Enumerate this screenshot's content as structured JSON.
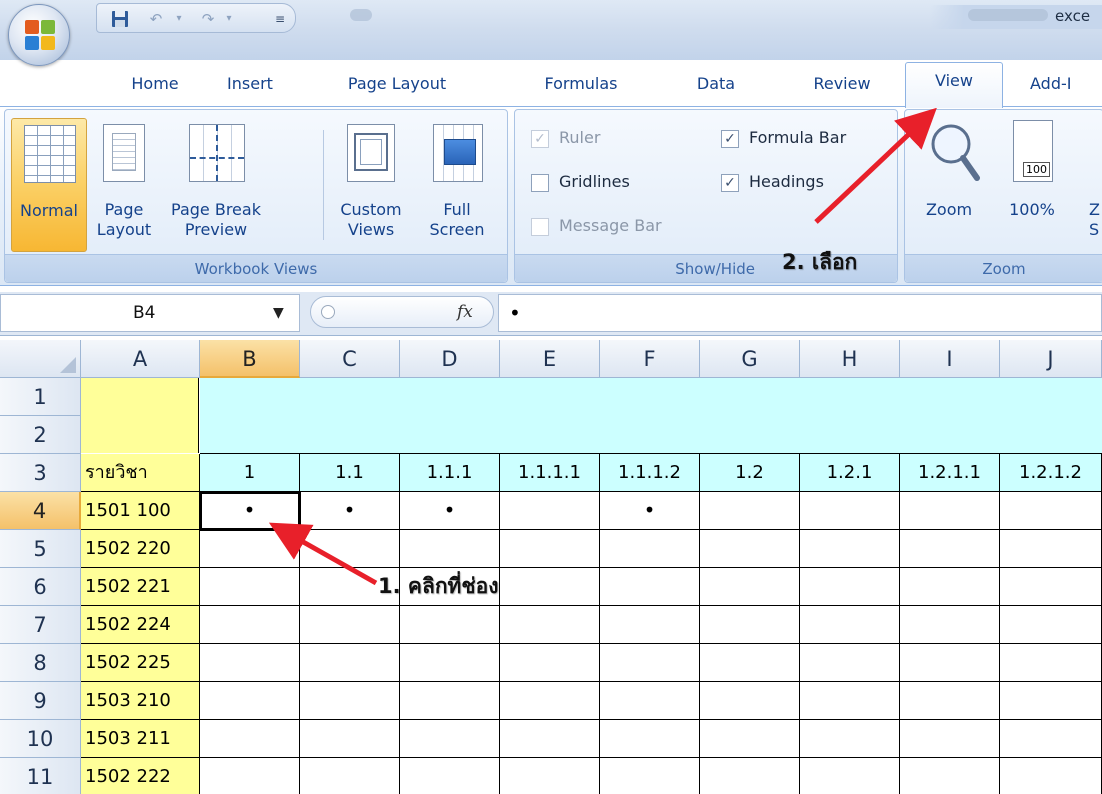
{
  "window": {
    "title_partial": "exce",
    "quick_access": {
      "save_icon": "save-icon",
      "undo_icon": "undo-icon",
      "redo_icon": "redo-icon",
      "customize_icon": "customize-qat-icon"
    }
  },
  "tabs": [
    {
      "label": "Home"
    },
    {
      "label": "Insert"
    },
    {
      "label": "Page Layout"
    },
    {
      "label": "Formulas"
    },
    {
      "label": "Data"
    },
    {
      "label": "Review"
    },
    {
      "label": "View",
      "active": true
    },
    {
      "label": "Add-I"
    }
  ],
  "ribbon": {
    "workbook_views": {
      "label": "Workbook Views",
      "normal": "Normal",
      "page_layout_1": "Page",
      "page_layout_2": "Layout",
      "page_break_1": "Page Break",
      "page_break_2": "Preview",
      "custom_views_1": "Custom",
      "custom_views_2": "Views",
      "full_screen_1": "Full",
      "full_screen_2": "Screen"
    },
    "show_hide": {
      "label": "Show/Hide",
      "ruler": {
        "label": "Ruler",
        "checked": true,
        "enabled": false
      },
      "gridlines": {
        "label": "Gridlines",
        "checked": false,
        "enabled": true
      },
      "message_bar": {
        "label": "Message Bar",
        "checked": false,
        "enabled": false
      },
      "formula_bar": {
        "label": "Formula Bar",
        "checked": true,
        "enabled": true
      },
      "headings": {
        "label": "Headings",
        "checked": true,
        "enabled": true
      }
    },
    "zoom": {
      "label": "Zoom",
      "zoom_btn": "Zoom",
      "hundred_btn": "100%",
      "hundred_icon_text": "100",
      "partial_1": "Z",
      "partial_2": "S"
    }
  },
  "formula_bar": {
    "name_box": "B4",
    "fx": "fx",
    "value": "•"
  },
  "sheet": {
    "columns": [
      "A",
      "B",
      "C",
      "D",
      "E",
      "F",
      "G",
      "H",
      "I",
      "J"
    ],
    "selected_column": "B",
    "selected_row": "4",
    "rows": [
      "1",
      "2",
      "3",
      "4",
      "5",
      "6",
      "7",
      "8",
      "9",
      "10",
      "11"
    ],
    "header_row": [
      "รายวิชา",
      "1",
      "1.1",
      "1.1.1",
      "1.1.1.1",
      "1.1.1.2",
      "1.2",
      "1.2.1",
      "1.2.1.1",
      "1.2.1.2"
    ],
    "subjects": [
      "1501 100",
      "1502 220",
      "1502 221",
      "1502 224",
      "1502 225",
      "1503 210",
      "1503 211",
      "1502 222"
    ],
    "row4_marks": [
      "•",
      "•",
      "•",
      "",
      "•",
      "",
      "",
      "",
      ""
    ],
    "colors": {
      "subject_fill": "#ffff99",
      "header_fill": "#ccffff",
      "arrow": "#e8202a"
    }
  },
  "annotations": {
    "step1": "1. คลิกที่ช่อง",
    "step2": "2. เลือก"
  }
}
